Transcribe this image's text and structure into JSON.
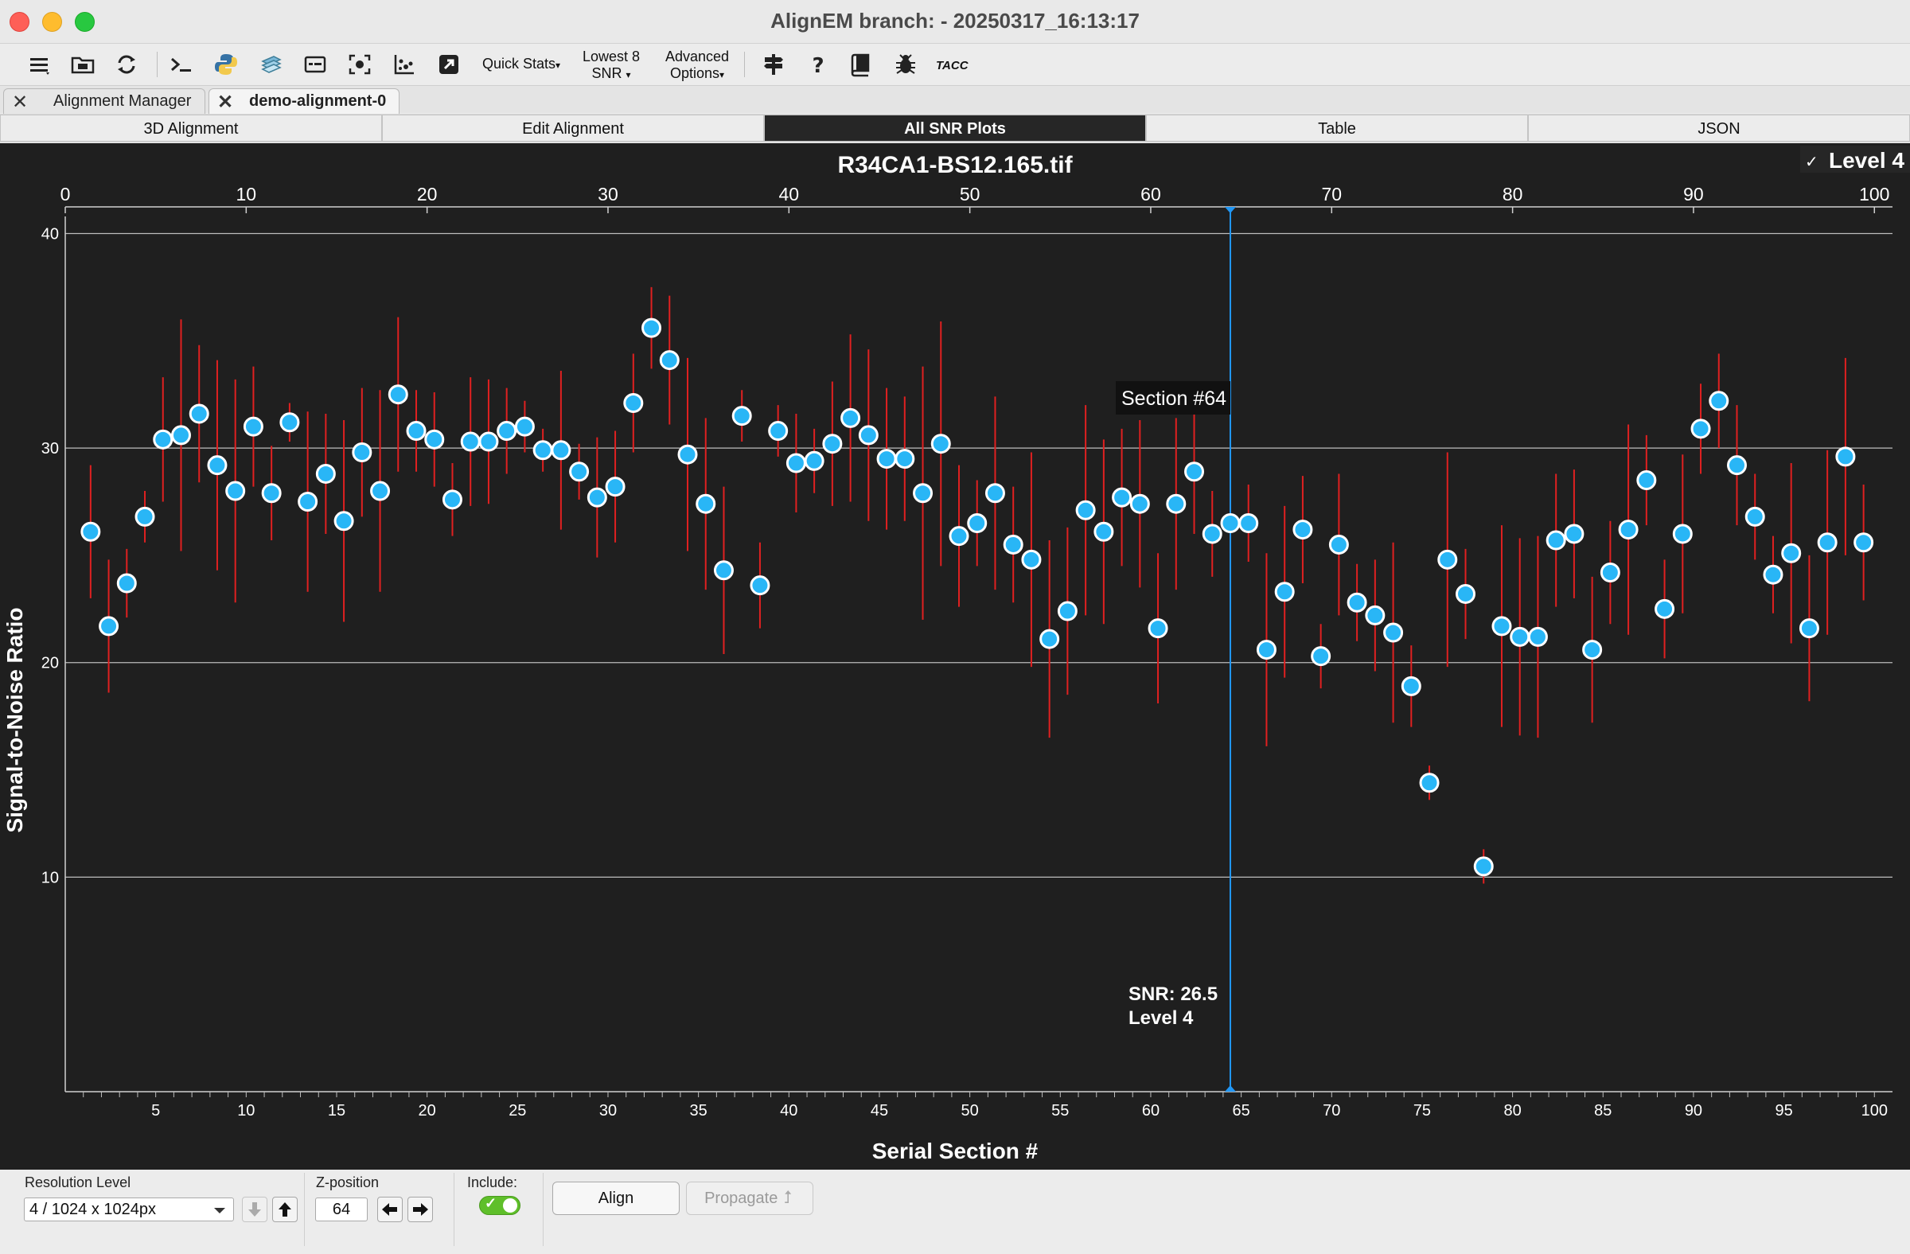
{
  "window": {
    "title": "AlignEM branch:  - 20250317_16:13:17"
  },
  "toolbar": {
    "icons": [
      "menu-icon",
      "folder-icon",
      "refresh-icon",
      "terminal-icon",
      "python-icon",
      "layers-icon",
      "window-icon",
      "focus-icon",
      "scatter-plot-icon",
      "export-icon",
      "signpost-icon",
      "help-icon",
      "book-icon",
      "bug-icon"
    ],
    "quick_stats": "Quick Stats",
    "lowest_line1": "Lowest 8",
    "lowest_line2": "SNR",
    "advanced_line1": "Advanced",
    "advanced_line2": "Options",
    "tacc_label": "TACC"
  },
  "doc_tabs": [
    {
      "label": "Alignment Manager"
    },
    {
      "label": "demo-alignment-0"
    }
  ],
  "view_tabs": [
    {
      "label": "3D Alignment"
    },
    {
      "label": "Edit Alignment"
    },
    {
      "label": "All SNR Plots"
    },
    {
      "label": "Table"
    },
    {
      "label": "JSON"
    }
  ],
  "plot": {
    "level_checkbox_label": "Level 4",
    "level_check_mark": "✓",
    "tooltip": "Section #64",
    "readout_snr": "SNR: 26.5",
    "readout_level": "Level 4",
    "accent_color": "#2196f3",
    "point_color": "#29b6f6",
    "errorbar_color": "#e02020"
  },
  "chart_data": {
    "type": "scatter",
    "title": "R34CA1-BS12.165.tif",
    "xlabel": "Serial Section #",
    "ylabel": "Signal-to-Noise Ratio",
    "xlim": [
      0,
      101
    ],
    "ylim": [
      0,
      40.5
    ],
    "y_ticks": [
      10,
      20,
      30,
      40
    ],
    "x_ticks_top": [
      0,
      10,
      20,
      30,
      40,
      50,
      60,
      70,
      80,
      90,
      100
    ],
    "x_ticks_bottom": [
      5,
      10,
      15,
      20,
      25,
      30,
      35,
      40,
      45,
      50,
      55,
      60,
      65,
      70,
      75,
      80,
      85,
      90,
      95,
      100
    ],
    "grid": true,
    "cursor_x": 64.4,
    "series": [
      {
        "x": [
          1.4,
          2.4,
          3.4,
          4.4,
          5.4,
          6.4,
          7.4,
          8.4,
          9.4,
          10.4,
          11.4,
          12.4,
          13.4,
          14.4,
          15.4,
          16.4,
          17.4,
          18.4,
          19.4,
          20.4,
          21.4,
          22.4,
          23.4,
          24.4,
          25.4,
          26.4,
          27.4,
          28.4,
          29.4,
          30.4,
          31.4,
          32.4,
          33.4,
          34.4,
          35.4,
          36.4,
          37.4,
          38.4,
          39.4,
          40.4,
          41.4,
          42.4,
          43.4,
          44.4,
          45.4,
          46.4,
          47.4,
          48.4,
          49.4,
          50.4,
          51.4,
          52.4,
          53.4,
          54.4,
          55.4,
          56.4,
          57.4,
          58.4,
          59.4,
          60.4,
          61.4,
          62.4,
          63.4,
          64.4,
          65.4,
          66.4,
          67.4,
          68.4,
          69.4,
          70.4,
          71.4,
          72.4,
          73.4,
          74.4,
          75.4,
          76.4,
          77.4,
          78.4,
          79.4,
          80.4,
          81.4,
          82.4,
          83.4,
          84.4,
          85.4,
          86.4,
          87.4,
          88.4,
          89.4,
          90.4,
          91.4,
          92.4,
          93.4,
          94.4,
          95.4,
          96.4,
          97.4,
          98.4,
          99.4
        ],
        "y": [
          26.1,
          21.7,
          23.7,
          26.8,
          30.4,
          30.6,
          31.6,
          29.2,
          28.0,
          31.0,
          27.9,
          31.2,
          27.5,
          28.8,
          26.6,
          29.8,
          28.0,
          32.5,
          30.8,
          30.4,
          27.6,
          30.3,
          30.3,
          30.8,
          31.0,
          29.9,
          29.9,
          28.9,
          27.7,
          28.2,
          32.1,
          35.6,
          34.1,
          29.7,
          27.4,
          24.3,
          31.5,
          23.6,
          30.8,
          29.3,
          29.4,
          30.2,
          31.4,
          30.6,
          29.5,
          29.5,
          27.9,
          30.2,
          25.9,
          26.5,
          27.9,
          25.5,
          24.8,
          21.1,
          22.4,
          27.1,
          26.1,
          27.7,
          27.4,
          21.6,
          27.4,
          28.9,
          26.0,
          26.5,
          26.5,
          20.6,
          23.3,
          26.2,
          20.3,
          25.5,
          22.8,
          22.2,
          21.4,
          18.9,
          14.4,
          24.8,
          23.2,
          10.5,
          21.7,
          21.2,
          21.2,
          25.7,
          26.0,
          20.6,
          24.2,
          26.2,
          28.5,
          22.5,
          26.0,
          30.9,
          32.2,
          29.2,
          26.8,
          24.1,
          25.1,
          21.6,
          25.6,
          29.6,
          25.6
        ],
        "err": [
          3.1,
          3.1,
          1.6,
          1.2,
          2.9,
          5.4,
          3.2,
          4.9,
          5.2,
          2.8,
          2.2,
          0.9,
          4.2,
          2.8,
          4.7,
          3.0,
          4.7,
          3.6,
          1.9,
          2.2,
          1.7,
          3.0,
          2.9,
          2.0,
          1.2,
          1.0,
          3.7,
          1.3,
          2.8,
          2.6,
          2.3,
          1.9,
          3.0,
          4.5,
          4.0,
          3.9,
          1.2,
          2.0,
          1.2,
          2.3,
          1.5,
          2.9,
          3.9,
          4.0,
          3.3,
          2.9,
          5.9,
          5.7,
          3.3,
          2.0,
          4.5,
          2.7,
          5.0,
          4.6,
          3.9,
          4.9,
          4.3,
          3.2,
          3.9,
          3.5,
          4.0,
          2.9,
          2.0,
          1.4,
          1.8,
          4.5,
          4.0,
          2.5,
          1.5,
          3.3,
          1.8,
          2.6,
          4.2,
          1.9,
          0.8,
          5.0,
          2.1,
          0.8,
          4.7,
          4.6,
          4.7,
          3.1,
          3.0,
          3.4,
          2.4,
          4.9,
          2.1,
          2.3,
          3.7,
          2.1,
          2.2,
          2.8,
          2.0,
          1.8,
          4.2,
          3.4,
          4.3,
          4.6,
          2.7
        ]
      }
    ]
  },
  "bottom": {
    "resolution_label": "Resolution Level",
    "resolution_value": "4 / 1024 x 1024px",
    "zpos_label": "Z-position",
    "zpos_value": "64",
    "include_label": "Include:",
    "include_checked": true,
    "align_label": "Align",
    "propagate_label": "Propagate"
  }
}
